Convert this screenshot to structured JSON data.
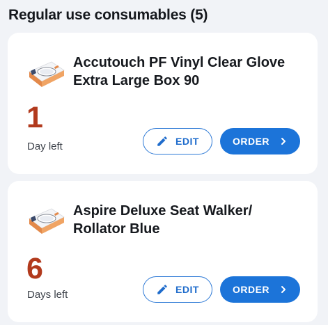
{
  "section": {
    "title": "Regular use consumables (5)"
  },
  "items": [
    {
      "name": "Accutouch PF Vinyl Clear Glove Extra Large Box 90",
      "days_value": "1",
      "days_label": "Day left",
      "thumbnail_icon": "glove-box-icon",
      "edit_label": "EDIT",
      "order_label": "ORDER"
    },
    {
      "name": "Aspire Deluxe Seat Walker/ Rollator Blue",
      "days_value": "6",
      "days_label": "Days left",
      "thumbnail_icon": "glove-box-icon",
      "edit_label": "EDIT",
      "order_label": "ORDER"
    }
  ],
  "colors": {
    "accent": "#1c74d9",
    "days_number": "#b23a1d",
    "background": "#f1f3f7"
  }
}
